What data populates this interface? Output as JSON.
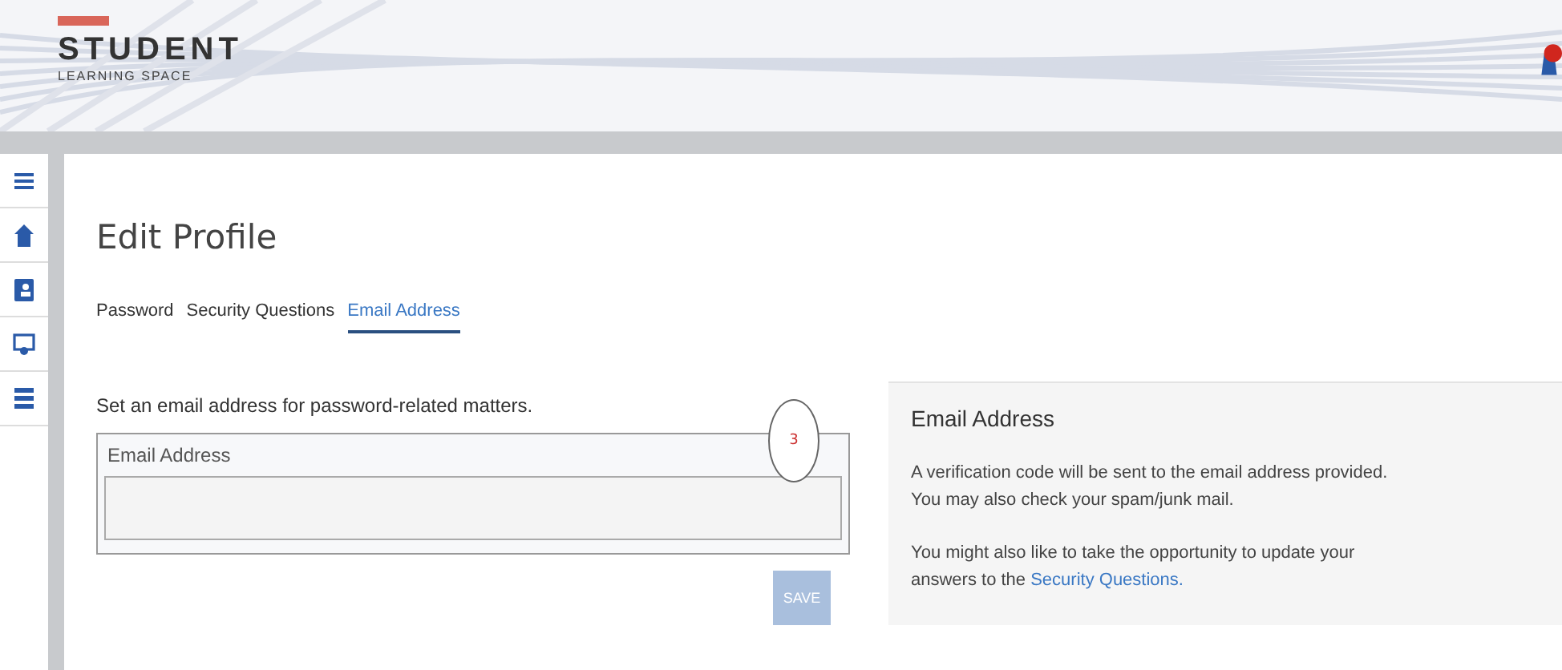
{
  "header": {
    "logo_title": "STUDENT",
    "logo_subtitle": "LEARNING SPACE"
  },
  "sidebar": {
    "items": [
      {
        "kind": "menu"
      },
      {
        "kind": "home"
      },
      {
        "kind": "profile"
      },
      {
        "kind": "screen"
      },
      {
        "kind": "list"
      }
    ]
  },
  "page": {
    "title": "Edit Profile",
    "tabs": [
      {
        "label": "Password",
        "selected": false
      },
      {
        "label": "Security Questions",
        "selected": false
      },
      {
        "label": "Email Address",
        "selected": true
      }
    ],
    "form": {
      "instruction": "Set an email address for password-related matters.",
      "step_marker": "3",
      "field_label": "Email Address",
      "save_button": "SAVE",
      "save_disabled": true
    },
    "info": {
      "title": "Email Address",
      "paragraph_1": "A verification code will be sent to the email address provided. You may also check your spam/junk mail.",
      "paragraph_2": "You might also like to take the opportunity to update your answers to the",
      "link": "Security Questions."
    }
  }
}
